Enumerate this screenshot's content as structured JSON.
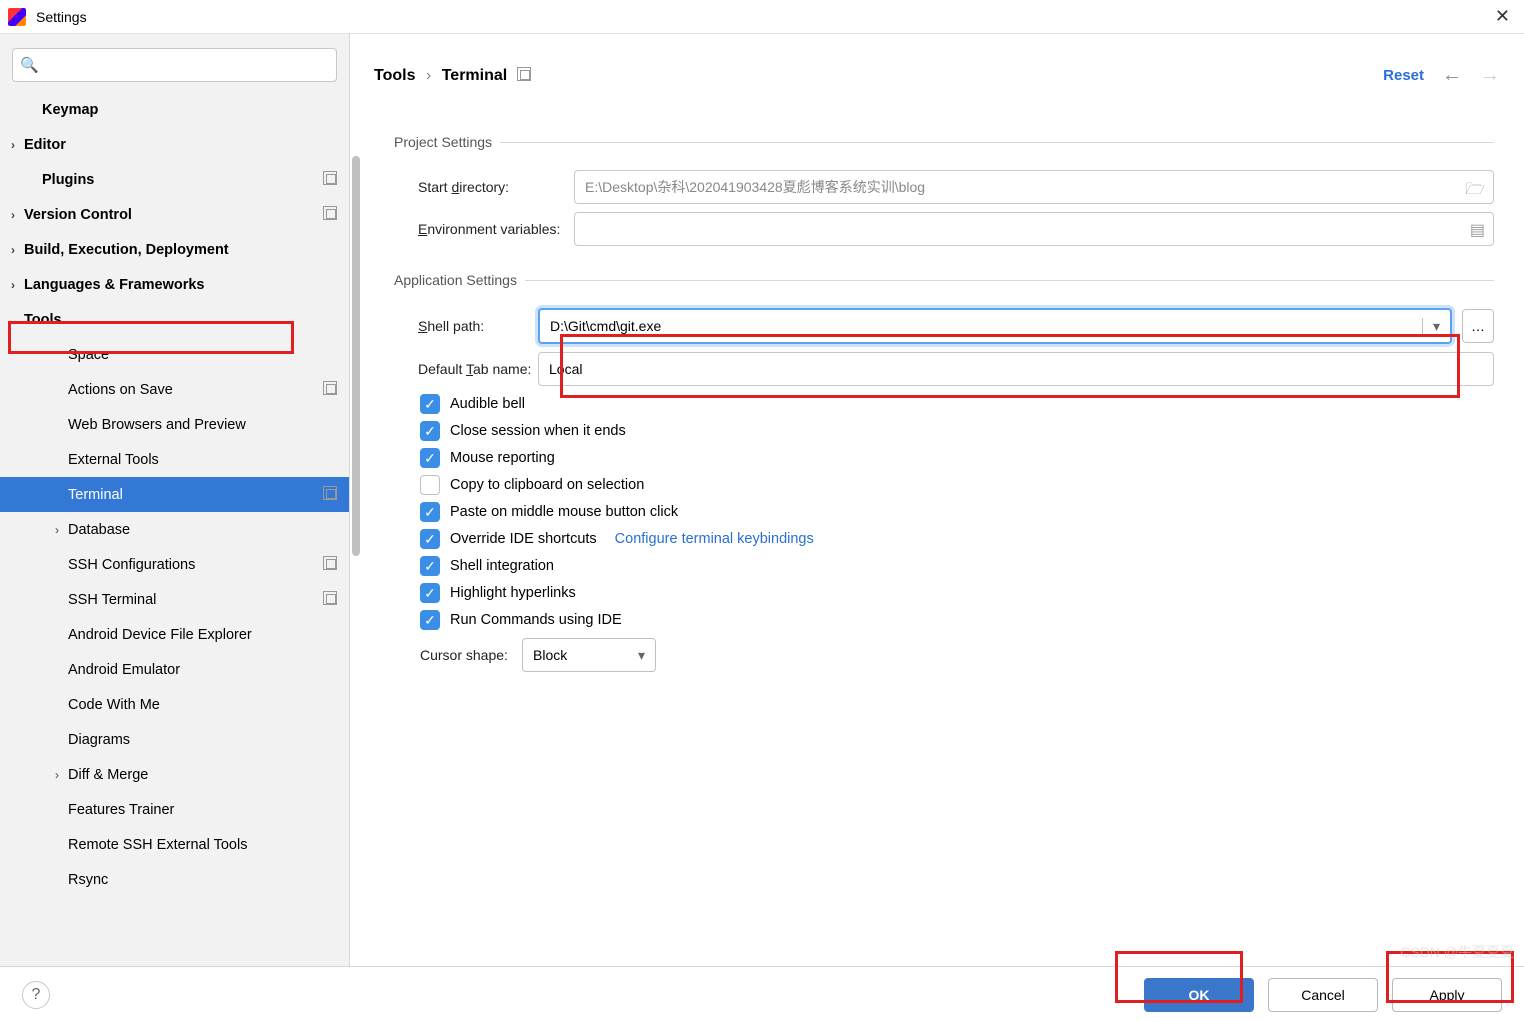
{
  "window": {
    "title": "Settings"
  },
  "sidebar": {
    "search_placeholder": "",
    "items": [
      {
        "label": "Keymap",
        "indent": "l1",
        "bold": true
      },
      {
        "label": "Editor",
        "indent": "",
        "bold": true,
        "chev": ">"
      },
      {
        "label": "Plugins",
        "indent": "l1",
        "bold": true,
        "badge": true
      },
      {
        "label": "Version Control",
        "indent": "",
        "bold": true,
        "chev": ">",
        "badge": true
      },
      {
        "label": "Build, Execution, Deployment",
        "indent": "",
        "bold": true,
        "chev": ">"
      },
      {
        "label": "Languages & Frameworks",
        "indent": "",
        "bold": true,
        "chev": ">"
      },
      {
        "label": "Tools",
        "indent": "",
        "bold": true,
        "chev": "v"
      },
      {
        "label": "Space",
        "indent": "l2"
      },
      {
        "label": "Actions on Save",
        "indent": "l2",
        "badge": true
      },
      {
        "label": "Web Browsers and Preview",
        "indent": "l2"
      },
      {
        "label": "External Tools",
        "indent": "l2"
      },
      {
        "label": "Terminal",
        "indent": "l2",
        "selected": true,
        "badge": true
      },
      {
        "label": "Database",
        "indent": "l2",
        "chev": ">"
      },
      {
        "label": "SSH Configurations",
        "indent": "l2",
        "badge": true
      },
      {
        "label": "SSH Terminal",
        "indent": "l2",
        "badge": true
      },
      {
        "label": "Android Device File Explorer",
        "indent": "l2"
      },
      {
        "label": "Android Emulator",
        "indent": "l2"
      },
      {
        "label": "Code With Me",
        "indent": "l2"
      },
      {
        "label": "Diagrams",
        "indent": "l2"
      },
      {
        "label": "Diff & Merge",
        "indent": "l2",
        "chev": ">"
      },
      {
        "label": "Features Trainer",
        "indent": "l2"
      },
      {
        "label": "Remote SSH External Tools",
        "indent": "l2"
      },
      {
        "label": "Rsync",
        "indent": "l2"
      }
    ]
  },
  "header": {
    "crumb1": "Tools",
    "crumb2": "Terminal",
    "reset": "Reset"
  },
  "sections": {
    "project": "Project Settings",
    "app": "Application Settings"
  },
  "fields": {
    "start_dir_label": "Start directory:",
    "start_dir_value": "E:\\Desktop\\杂科\\202041903428夏彪博客系统实训\\blog",
    "env_label": "Environment variables:",
    "env_value": "",
    "shell_label": "Shell path:",
    "shell_value": "D:\\Git\\cmd\\git.exe",
    "tab_label": "Default Tab name:",
    "tab_value": "Local",
    "cursor_label": "Cursor shape:",
    "cursor_value": "Block"
  },
  "checks": [
    {
      "label": "Audible bell",
      "checked": true
    },
    {
      "label": "Close session when it ends",
      "checked": true
    },
    {
      "label": "Mouse reporting",
      "checked": true
    },
    {
      "label": "Copy to clipboard on selection",
      "checked": false
    },
    {
      "label": "Paste on middle mouse button click",
      "checked": true
    },
    {
      "label": "Override IDE shortcuts",
      "checked": true,
      "link": "Configure terminal keybindings"
    },
    {
      "label": "Shell integration",
      "checked": true
    },
    {
      "label": "Highlight hyperlinks",
      "checked": true
    },
    {
      "label": "Run Commands using IDE",
      "checked": true
    }
  ],
  "footer": {
    "ok": "OK",
    "cancel": "Cancel",
    "apply": "Apply"
  },
  "watermark": "CSDN @牛夏夏夏"
}
